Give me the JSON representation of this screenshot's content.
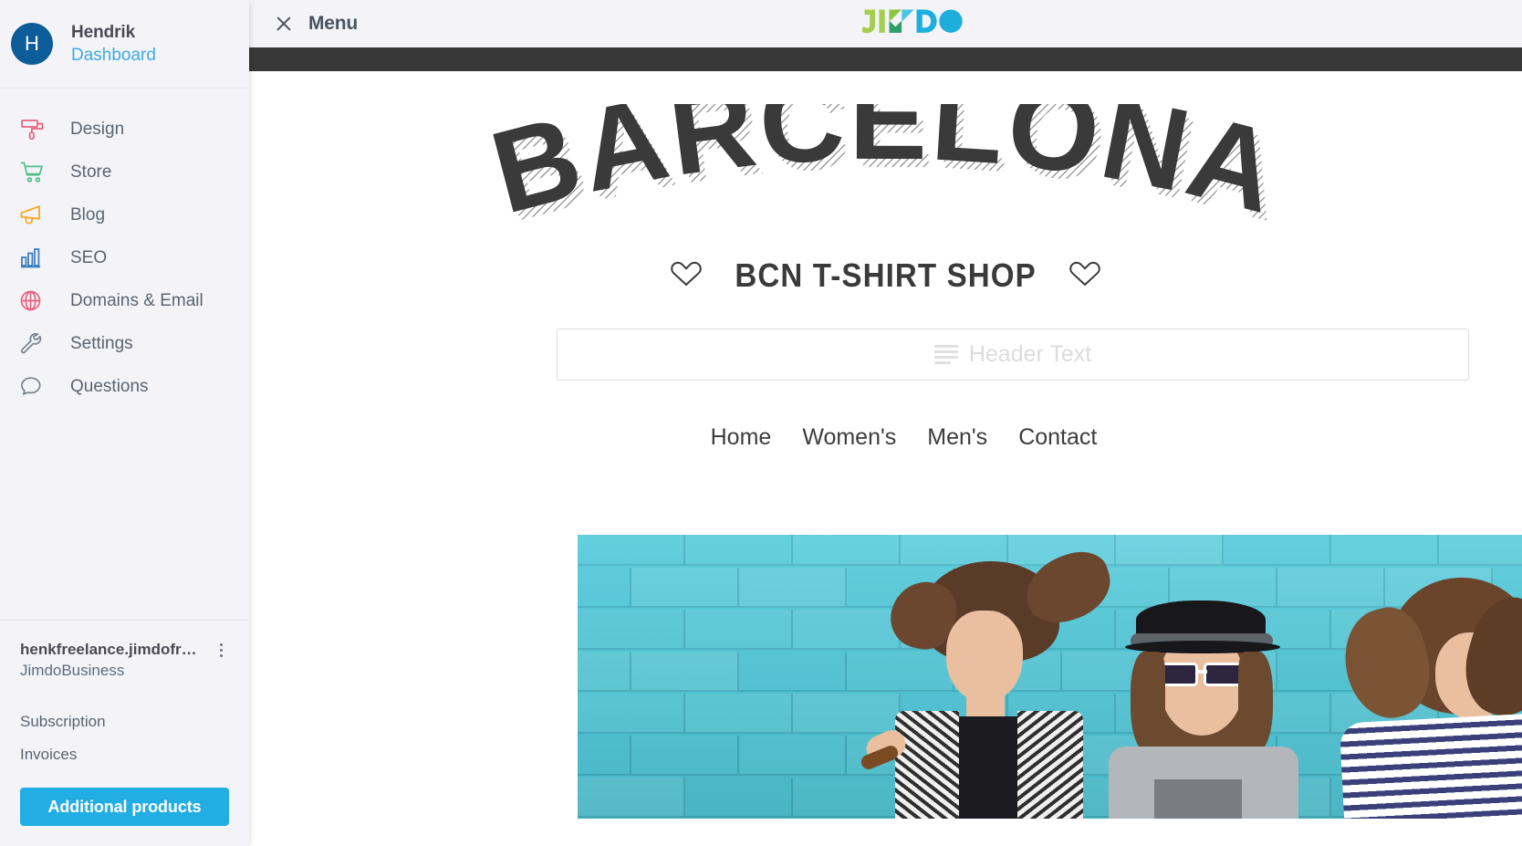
{
  "sidebar": {
    "profile": {
      "avatar_initial": "H",
      "avatar_color": "#0b5c98",
      "name": "Hendrik",
      "subtitle": "Dashboard",
      "subtitle_color": "#3fa9e5"
    },
    "items": [
      {
        "label": "Design",
        "icon": "paint-roller-icon",
        "color": "#e8617d"
      },
      {
        "label": "Store",
        "icon": "shopping-cart-icon",
        "color": "#4cc08a"
      },
      {
        "label": "Blog",
        "icon": "megaphone-icon",
        "color": "#f5a623"
      },
      {
        "label": "SEO",
        "icon": "bar-chart-icon",
        "color": "#3d7ebf"
      },
      {
        "label": "Domains & Email",
        "icon": "globe-icon",
        "color": "#e8617d"
      },
      {
        "label": "Settings",
        "icon": "wrench-icon",
        "color": "#7b8290"
      },
      {
        "label": "Questions",
        "icon": "speech-bubble-icon",
        "color": "#7b8290"
      }
    ],
    "site": {
      "domain": "henkfreelance.jimdofr…",
      "plan": "JimdoBusiness",
      "menu_icon": "kebab-menu-icon",
      "links": [
        {
          "label": "Subscription"
        },
        {
          "label": "Invoices"
        }
      ],
      "cta_label": "Additional products",
      "cta_color": "#22aee4"
    }
  },
  "topbar": {
    "close_icon": "close-icon",
    "menu_label": "Menu",
    "logo": {
      "name": "jimdo-logo",
      "text": "JIMDO",
      "green": "#a5ce4e",
      "teal": "#2e9e6b",
      "light_green": "#8cc63f",
      "blue": "#1eaede"
    }
  },
  "preview": {
    "dark_bar_color": "#383838",
    "hero_title": "BARCELONA",
    "tagline": "BCN T-SHIRT SHOP",
    "tagline_left_icon": "heart-outline-icon",
    "tagline_right_icon": "heart-outline-icon",
    "header_placeholder": {
      "icon": "text-lines-icon",
      "text": "Header Text"
    },
    "nav": [
      {
        "label": "Home"
      },
      {
        "label": "Women's"
      },
      {
        "label": "Men's"
      },
      {
        "label": "Contact"
      }
    ],
    "banner": {
      "name": "hero-photo-banner",
      "wall_color": "#4fc8d9",
      "alt": "Three young people posing against a turquoise brick wall"
    }
  }
}
